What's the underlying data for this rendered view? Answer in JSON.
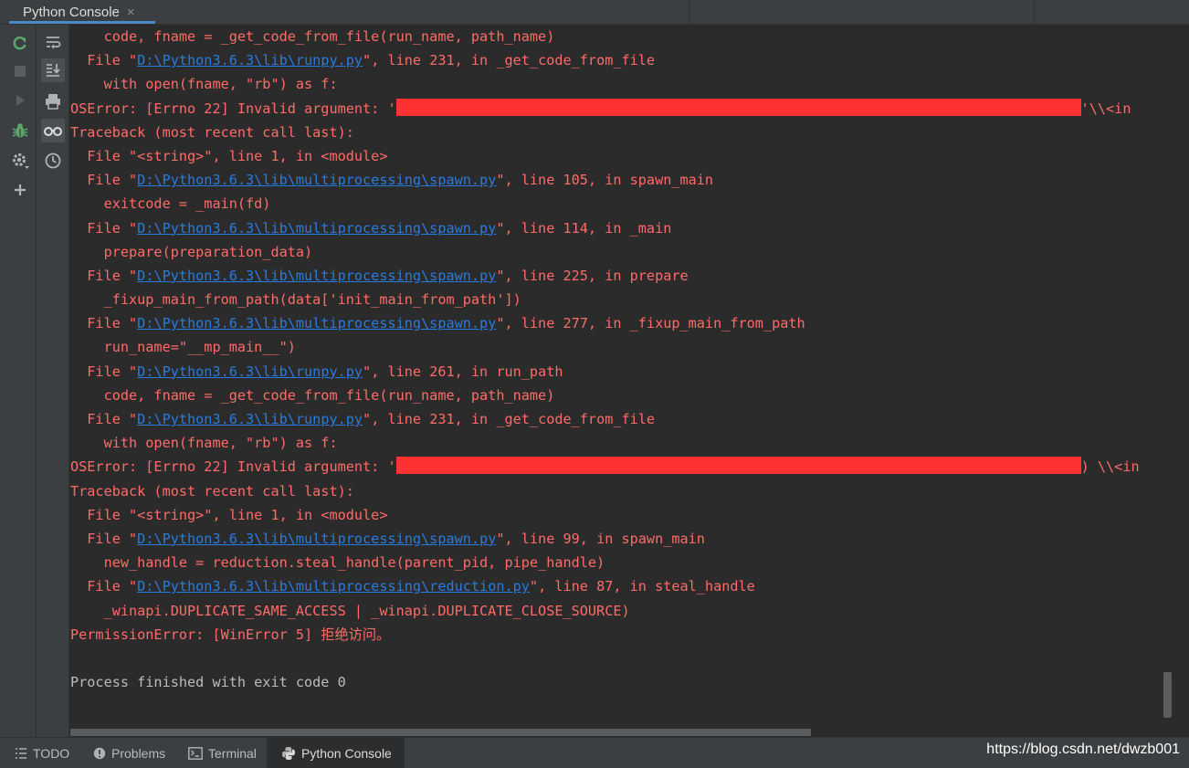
{
  "tab": {
    "title": "Python Console",
    "close": "×"
  },
  "console_lines": [
    {
      "kind": "err",
      "parts": [
        {
          "t": "    code, fname = _get_code_from_file(run_name, path_name)"
        }
      ]
    },
    {
      "kind": "err",
      "parts": [
        {
          "t": "  File \""
        },
        {
          "t": "D:\\Python3.6.3\\lib\\runpy.py",
          "link": true
        },
        {
          "t": "\", line 231, in _get_code_from_file"
        }
      ]
    },
    {
      "kind": "err",
      "parts": [
        {
          "t": "    with open(fname, \"rb\") as f:"
        }
      ]
    },
    {
      "kind": "err",
      "parts": [
        {
          "t": "OSError: [Errno 22] Invalid argument: '"
        },
        {
          "redact": 75
        },
        {
          "t": "'\\\\<in"
        }
      ]
    },
    {
      "kind": "err",
      "parts": [
        {
          "t": "Traceback (most recent call last):"
        }
      ]
    },
    {
      "kind": "err",
      "parts": [
        {
          "t": "  File \"<string>\", line 1, in <module>"
        }
      ]
    },
    {
      "kind": "err",
      "parts": [
        {
          "t": "  File \""
        },
        {
          "t": "D:\\Python3.6.3\\lib\\multiprocessing\\spawn.py",
          "link": true
        },
        {
          "t": "\", line 105, in spawn_main"
        }
      ]
    },
    {
      "kind": "err",
      "parts": [
        {
          "t": "    exitcode = _main(fd)"
        }
      ]
    },
    {
      "kind": "err",
      "parts": [
        {
          "t": "  File \""
        },
        {
          "t": "D:\\Python3.6.3\\lib\\multiprocessing\\spawn.py",
          "link": true
        },
        {
          "t": "\", line 114, in _main"
        }
      ]
    },
    {
      "kind": "err",
      "parts": [
        {
          "t": "    prepare(preparation_data)"
        }
      ]
    },
    {
      "kind": "err",
      "parts": [
        {
          "t": "  File \""
        },
        {
          "t": "D:\\Python3.6.3\\lib\\multiprocessing\\spawn.py",
          "link": true
        },
        {
          "t": "\", line 225, in prepare"
        }
      ]
    },
    {
      "kind": "err",
      "parts": [
        {
          "t": "    _fixup_main_from_path(data['init_main_from_path'])"
        }
      ]
    },
    {
      "kind": "err",
      "parts": [
        {
          "t": "  File \""
        },
        {
          "t": "D:\\Python3.6.3\\lib\\multiprocessing\\spawn.py",
          "link": true
        },
        {
          "t": "\", line 277, in _fixup_main_from_path"
        }
      ]
    },
    {
      "kind": "err",
      "parts": [
        {
          "t": "    run_name=\"__mp_main__\")"
        }
      ]
    },
    {
      "kind": "err",
      "parts": [
        {
          "t": "  File \""
        },
        {
          "t": "D:\\Python3.6.3\\lib\\runpy.py",
          "link": true
        },
        {
          "t": "\", line 261, in run_path"
        }
      ]
    },
    {
      "kind": "err",
      "parts": [
        {
          "t": "    code, fname = _get_code_from_file(run_name, path_name)"
        }
      ]
    },
    {
      "kind": "err",
      "parts": [
        {
          "t": "  File \""
        },
        {
          "t": "D:\\Python3.6.3\\lib\\runpy.py",
          "link": true
        },
        {
          "t": "\", line 231, in _get_code_from_file"
        }
      ]
    },
    {
      "kind": "err",
      "parts": [
        {
          "t": "    with open(fname, \"rb\") as f:"
        }
      ]
    },
    {
      "kind": "err",
      "parts": [
        {
          "t": "OSError: [Errno 22] Invalid argument: '"
        },
        {
          "redact": 75
        },
        {
          "t": ") \\\\<in"
        }
      ]
    },
    {
      "kind": "err",
      "parts": [
        {
          "t": "Traceback (most recent call last):"
        }
      ]
    },
    {
      "kind": "err",
      "parts": [
        {
          "t": "  File \"<string>\", line 1, in <module>"
        }
      ]
    },
    {
      "kind": "err",
      "parts": [
        {
          "t": "  File \""
        },
        {
          "t": "D:\\Python3.6.3\\lib\\multiprocessing\\spawn.py",
          "link": true
        },
        {
          "t": "\", line 99, in spawn_main"
        }
      ]
    },
    {
      "kind": "err",
      "parts": [
        {
          "t": "    new_handle = reduction.steal_handle(parent_pid, pipe_handle)"
        }
      ]
    },
    {
      "kind": "err",
      "parts": [
        {
          "t": "  File \""
        },
        {
          "t": "D:\\Python3.6.3\\lib\\multiprocessing\\reduction.py",
          "link": true
        },
        {
          "t": "\", line 87, in steal_handle"
        }
      ]
    },
    {
      "kind": "err",
      "parts": [
        {
          "t": "    _winapi.DUPLICATE_SAME_ACCESS | _winapi.DUPLICATE_CLOSE_SOURCE)"
        }
      ]
    },
    {
      "kind": "err",
      "parts": [
        {
          "t": "PermissionError: [WinError 5] 拒绝访问。"
        }
      ]
    },
    {
      "kind": "normal",
      "parts": [
        {
          "t": ""
        }
      ]
    },
    {
      "kind": "normal",
      "parts": [
        {
          "t": "Process finished with exit code 0"
        }
      ]
    }
  ],
  "left_toolbar": [
    {
      "name": "rerun-icon",
      "color": "#59a869"
    },
    {
      "name": "stop-icon",
      "color": "#5a5d5f"
    },
    {
      "name": "run-icon",
      "color": "#5a5d5f"
    },
    {
      "name": "debug-icon",
      "color": "#59a869"
    },
    {
      "name": "settings-icon",
      "color": "#afb1b3"
    },
    {
      "name": "add-icon",
      "color": "#afb1b3"
    }
  ],
  "right_toolbar": [
    {
      "name": "soft-wrap-icon"
    },
    {
      "name": "scroll-to-end-icon"
    },
    {
      "name": "print-icon"
    },
    {
      "name": "show-variables-icon"
    },
    {
      "name": "history-icon"
    }
  ],
  "bottom_tools": [
    {
      "label": "TODO",
      "icon": "todo-icon"
    },
    {
      "label": "Problems",
      "icon": "problems-icon"
    },
    {
      "label": "Terminal",
      "icon": "terminal-icon"
    },
    {
      "label": "Python Console",
      "icon": "python-icon",
      "active": true
    }
  ],
  "watermark": "https://blog.csdn.net/dwzb001",
  "colors": {
    "error": "#ff6b68",
    "link": "#287bde",
    "normal": "#bbbbbb",
    "background": "#2b2b2b",
    "accent": "#4a88c7"
  }
}
